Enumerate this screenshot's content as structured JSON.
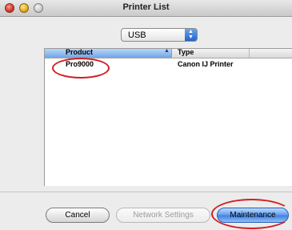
{
  "window": {
    "title": "Printer List"
  },
  "port_select": {
    "value": "USB",
    "icon": "updown-arrows-icon"
  },
  "list": {
    "columns": [
      {
        "label": "Product",
        "sort_icon": "sort-ascending-icon"
      },
      {
        "label": "Type"
      }
    ],
    "rows": [
      {
        "product": "Pro9000",
        "type": "Canon IJ Printer"
      }
    ]
  },
  "buttons": {
    "cancel": "Cancel",
    "network_settings": "Network Settings",
    "maintenance": "Maintenance"
  },
  "colors": {
    "selected_header": "#6fa6e6",
    "default_button": "#3f7fe0",
    "annotation": "#d01f22"
  }
}
